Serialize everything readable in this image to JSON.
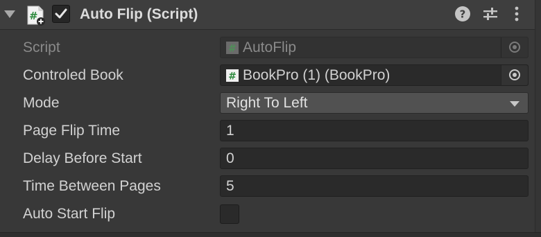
{
  "component": {
    "title": "Auto Flip (Script)",
    "enabled": true
  },
  "icons": {
    "script": "script-hash-icon",
    "help": "help-icon",
    "presets": "presets-sliders-icon",
    "menu": "kebab-menu-icon"
  },
  "colors": {
    "panel_bg": "#383838",
    "header_bg": "#3e3e3e",
    "field_bg": "#2a2a2a",
    "dropdown_bg": "#515151",
    "text": "#d2d2d2",
    "disabled_text": "#8a8a8a",
    "script_icon_green": "#2e8b3e"
  },
  "fields": {
    "script": {
      "label": "Script",
      "value": "AutoFlip"
    },
    "controlled_book": {
      "label": "Controled Book",
      "value": "BookPro (1) (BookPro)"
    },
    "mode": {
      "label": "Mode",
      "value": "Right To Left"
    },
    "page_flip_time": {
      "label": "Page Flip Time",
      "value": "1"
    },
    "delay_before_start": {
      "label": "Delay Before Start",
      "value": "0"
    },
    "time_between_pages": {
      "label": "Time Between Pages",
      "value": "5"
    },
    "auto_start_flip": {
      "label": "Auto Start Flip",
      "checked": false
    }
  }
}
